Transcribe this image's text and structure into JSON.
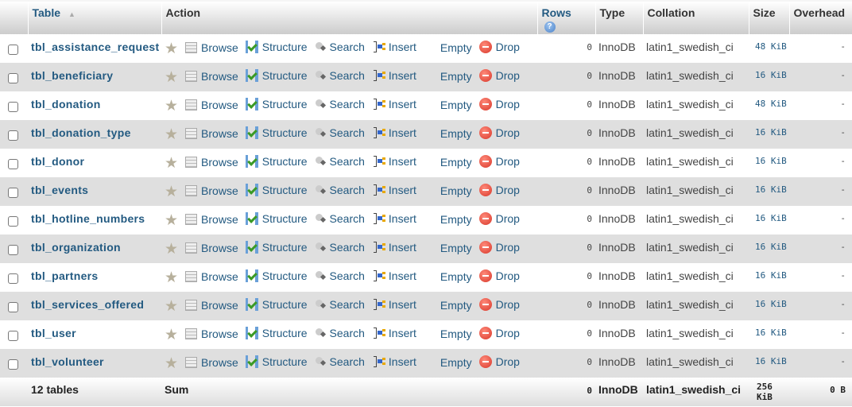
{
  "header": {
    "table": "Table",
    "sort_indicator": "▲",
    "action": "Action",
    "rows": "Rows",
    "rows_help": "?",
    "type": "Type",
    "collation": "Collation",
    "size": "Size",
    "overhead": "Overhead"
  },
  "actions": {
    "browse": "Browse",
    "structure": "Structure",
    "search": "Search",
    "insert": "Insert",
    "empty": "Empty",
    "drop": "Drop"
  },
  "tables": [
    {
      "name": "tbl_assistance_request",
      "rows": "0",
      "type": "InnoDB",
      "collation": "latin1_swedish_ci",
      "size": "48 KiB",
      "overhead": "-"
    },
    {
      "name": "tbl_beneficiary",
      "rows": "0",
      "type": "InnoDB",
      "collation": "latin1_swedish_ci",
      "size": "16 KiB",
      "overhead": "-"
    },
    {
      "name": "tbl_donation",
      "rows": "0",
      "type": "InnoDB",
      "collation": "latin1_swedish_ci",
      "size": "48 KiB",
      "overhead": "-"
    },
    {
      "name": "tbl_donation_type",
      "rows": "0",
      "type": "InnoDB",
      "collation": "latin1_swedish_ci",
      "size": "16 KiB",
      "overhead": "-"
    },
    {
      "name": "tbl_donor",
      "rows": "0",
      "type": "InnoDB",
      "collation": "latin1_swedish_ci",
      "size": "16 KiB",
      "overhead": "-"
    },
    {
      "name": "tbl_events",
      "rows": "0",
      "type": "InnoDB",
      "collation": "latin1_swedish_ci",
      "size": "16 KiB",
      "overhead": "-"
    },
    {
      "name": "tbl_hotline_numbers",
      "rows": "0",
      "type": "InnoDB",
      "collation": "latin1_swedish_ci",
      "size": "16 KiB",
      "overhead": "-"
    },
    {
      "name": "tbl_organization",
      "rows": "0",
      "type": "InnoDB",
      "collation": "latin1_swedish_ci",
      "size": "16 KiB",
      "overhead": "-"
    },
    {
      "name": "tbl_partners",
      "rows": "0",
      "type": "InnoDB",
      "collation": "latin1_swedish_ci",
      "size": "16 KiB",
      "overhead": "-"
    },
    {
      "name": "tbl_services_offered",
      "rows": "0",
      "type": "InnoDB",
      "collation": "latin1_swedish_ci",
      "size": "16 KiB",
      "overhead": "-"
    },
    {
      "name": "tbl_user",
      "rows": "0",
      "type": "InnoDB",
      "collation": "latin1_swedish_ci",
      "size": "16 KiB",
      "overhead": "-"
    },
    {
      "name": "tbl_volunteer",
      "rows": "0",
      "type": "InnoDB",
      "collation": "latin1_swedish_ci",
      "size": "16 KiB",
      "overhead": "-"
    }
  ],
  "footer": {
    "count": "12 tables",
    "sum": "Sum",
    "rows": "0",
    "type": "InnoDB",
    "collation": "latin1_swedish_ci",
    "size": "256 KiB",
    "overhead": "0 B"
  }
}
